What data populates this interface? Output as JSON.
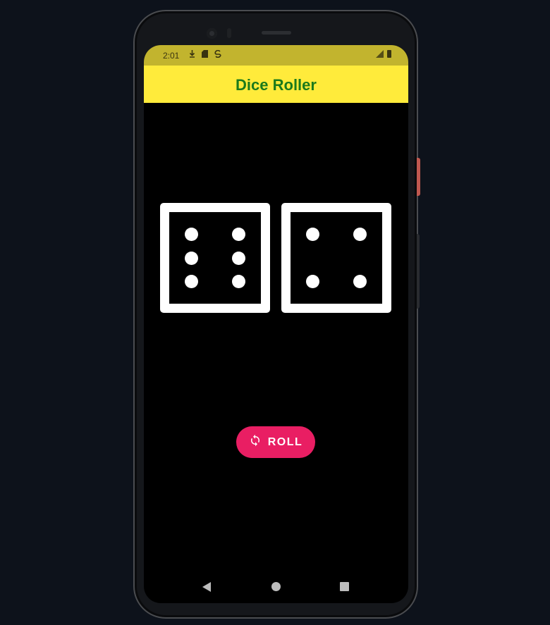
{
  "status_bar": {
    "time": "2:01",
    "left_icons": [
      "download-icon",
      "sd-card-icon",
      "sync-icon"
    ],
    "right_icons": [
      "signal-icon",
      "battery-icon"
    ],
    "background": "#c2b42e"
  },
  "app_bar": {
    "title": "Dice Roller",
    "background": "#ffeb3b",
    "title_color": "#1b7a1b"
  },
  "dice": [
    {
      "value": 6
    },
    {
      "value": 4
    }
  ],
  "roll_button": {
    "label": "ROLL",
    "icon": "refresh-icon",
    "color": "#e91e63"
  },
  "nav_bar": {
    "buttons": [
      "back",
      "home",
      "recents"
    ]
  }
}
